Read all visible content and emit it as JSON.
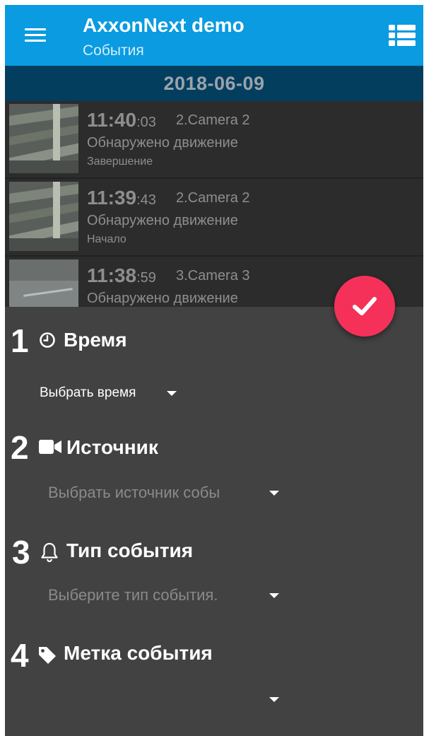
{
  "app": {
    "title": "AxxonNext demo",
    "subtitle": "События"
  },
  "date_header": "2018-06-09",
  "events": [
    {
      "time_hm": "11:40",
      "time_sec": ":03",
      "camera": "2.Camera 2",
      "type": "Обнаружено движение",
      "phase": "Завершение"
    },
    {
      "time_hm": "11:39",
      "time_sec": ":43",
      "camera": "2.Camera 2",
      "type": "Обнаружено движение",
      "phase": "Начало"
    },
    {
      "time_hm": "11:38",
      "time_sec": ":59",
      "camera": "3.Camera 3",
      "type": "Обнаружено движение",
      "phase": ""
    }
  ],
  "filter": {
    "sections": [
      {
        "number": "1",
        "icon": "clock-icon",
        "title": "Время",
        "dropdown": "Выбрать время"
      },
      {
        "number": "2",
        "icon": "video-camera-icon",
        "title": "Источник",
        "dropdown": "Выбрать источник собы"
      },
      {
        "number": "3",
        "icon": "bell-icon",
        "title": "Тип события",
        "dropdown": "Выберите тип события."
      },
      {
        "number": "4",
        "icon": "tag-icon",
        "title": "Метка события",
        "dropdown": ""
      }
    ]
  },
  "colors": {
    "appbar": "#0a9be0",
    "date_bar": "#043e5f",
    "fab": "#f5315a",
    "panel": "#424242",
    "list_row": "#2c2c2c"
  }
}
